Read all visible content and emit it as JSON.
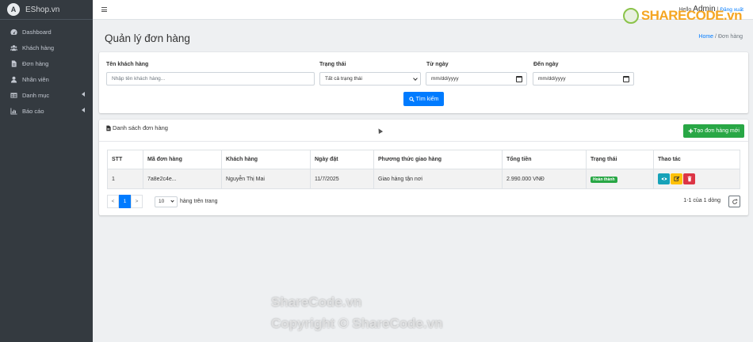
{
  "brand": {
    "name": "EShop.vn",
    "logo_letter": "A"
  },
  "sidebar": {
    "items": [
      {
        "label": "Dashboard",
        "icon": "dashboard-icon"
      },
      {
        "label": "Khách hàng",
        "icon": "users-icon"
      },
      {
        "label": "Đơn hàng",
        "icon": "file-icon"
      },
      {
        "label": "Nhân viên",
        "icon": "user-icon"
      },
      {
        "label": "Danh mục",
        "icon": "table-icon"
      },
      {
        "label": "Báo cáo",
        "icon": "chart-icon"
      }
    ]
  },
  "topbar": {
    "hello": "Hello",
    "admin": "Admin",
    "sep": " | ",
    "logout": "Đăng xuất"
  },
  "page": {
    "title": "Quản lý đơn hàng"
  },
  "breadcrumb": {
    "home": "Home",
    "sep": "/",
    "current": "Đơn hàng"
  },
  "filter": {
    "customer_label": "Tên khách hàng",
    "customer_placeholder": "Nhập tên khách hàng...",
    "status_label": "Trạng thái",
    "status_value": "Tất cả trạng thái",
    "from_label": "Từ ngày",
    "from_value": "mm/dd/yyyy",
    "to_label": "Đến ngày",
    "to_value": "mm/dd/yyyy",
    "search_button": "Tìm kiếm"
  },
  "list": {
    "title": "Danh sách đơn hàng",
    "create_button": "Tạo đơn hàng mới",
    "columns": [
      "STT",
      "Mã đơn hàng",
      "Khách hàng",
      "Ngày đặt",
      "Phương thức giao hàng",
      "Tổng tiền",
      "Trạng thái",
      "Thao tác"
    ],
    "rows": [
      {
        "stt": "1",
        "code": "7a8e2c4e...",
        "customer": "Nguyễn Thị Mai",
        "date": "11/7/2025",
        "shipping": "Giao hàng tận nơi",
        "total": "2.990.000 VNĐ",
        "status": "Hoàn thành"
      }
    ],
    "pager": {
      "prev": "<",
      "page": "1",
      "next": ">"
    },
    "rows_per_page": "10",
    "rows_per_page_label": "hàng trên trang",
    "count_text": "1-1 của 1 dòng"
  },
  "watermark": {
    "logo": "SHARECODE.vn",
    "line1": "ShareCode.vn",
    "line2": "Copyright © ShareCode.vn"
  },
  "colors": {
    "primary": "#007bff",
    "success": "#28a745",
    "sidebar": "#343a40",
    "info": "#17a2b8",
    "warning": "#ffc107",
    "danger": "#dc3545"
  }
}
